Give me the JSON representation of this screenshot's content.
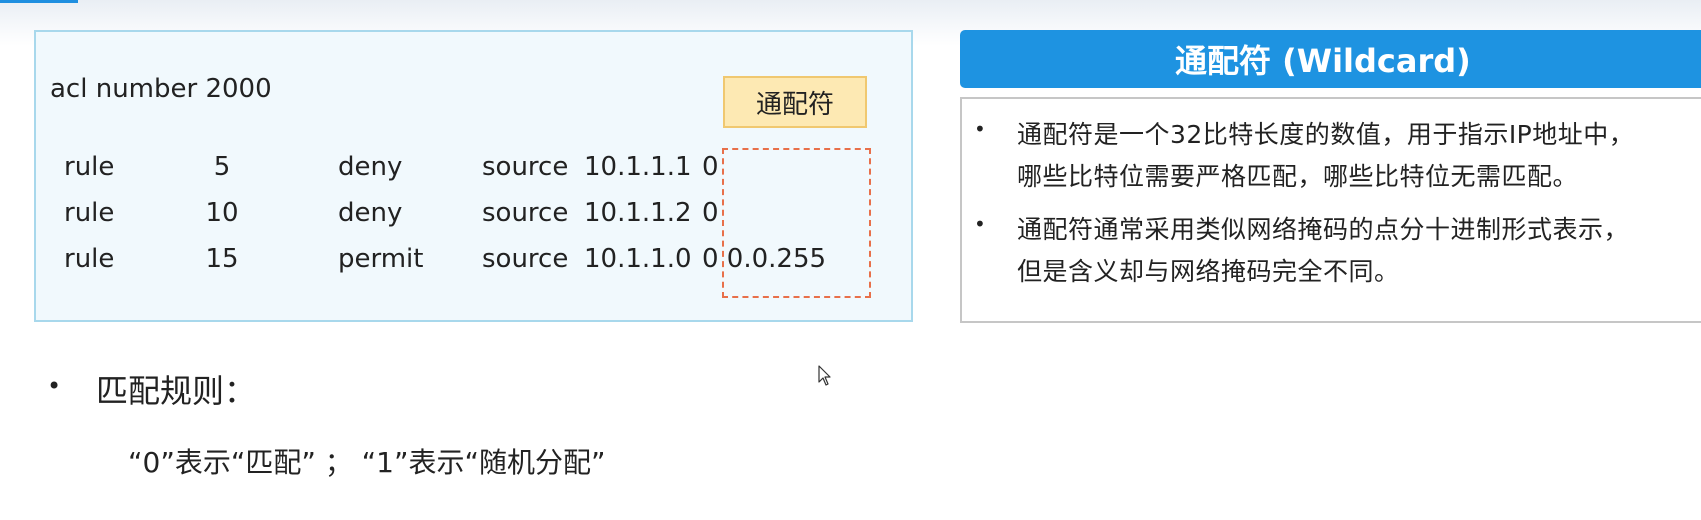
{
  "acl": {
    "title": "acl number 2000",
    "rules": [
      {
        "kw": "rule",
        "num": "5",
        "action": "deny",
        "src": "source",
        "ip": "10.1.1.1",
        "wildcard": "0"
      },
      {
        "kw": "rule",
        "num": "10",
        "action": "deny",
        "src": "source",
        "ip": "10.1.1.2",
        "wildcard": "0"
      },
      {
        "kw": "rule",
        "num": "15",
        "action": "permit",
        "src": "source",
        "ip": "10.1.1.0",
        "wildcard": "0 0.0.255"
      }
    ],
    "wildcard_tag": "通配符"
  },
  "wildcard_panel": {
    "title": "通配符 (Wildcard)",
    "bullets": [
      {
        "lines": [
          "通配符是一个32比特长度的数值，用于指示IP地址中，",
          "哪些比特位需要严格匹配，哪些比特位无需匹配。"
        ]
      },
      {
        "lines": [
          "通配符通常采用类似网络掩码的点分十进制形式表示，",
          "但是含义却与网络掩码完全不同。"
        ]
      }
    ],
    "bullet_symbol": "•"
  },
  "match": {
    "bullet": "•",
    "title": "匹配规则：",
    "desc": "“0”表示“匹配” ； “1”表示“随机分配”"
  },
  "colors": {
    "accent": "#1e93e1",
    "code_box_bg": "#f1f9fd",
    "tag_bg": "#fde9b3",
    "dash": "#e8704a"
  },
  "icons": {
    "cursor": "mouse-pointer-icon"
  }
}
